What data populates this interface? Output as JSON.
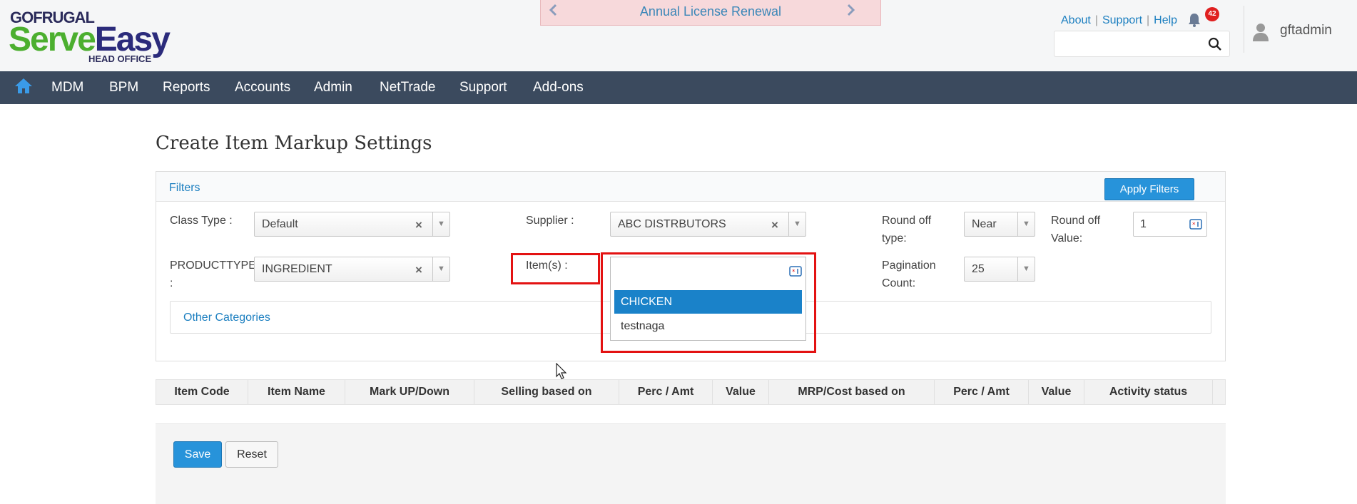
{
  "brand": {
    "top": "GOFRUGAL",
    "serve": "Serve",
    "easy": "Easy",
    "sub": "HEAD OFFICE"
  },
  "banner": {
    "text": "Annual License Renewal",
    "prev_icon": "chevron-left-icon",
    "next_icon": "chevron-right-icon"
  },
  "toplinks": {
    "about": "About",
    "support": "Support",
    "help": "Help",
    "notifications": "42"
  },
  "search": {
    "placeholder": "",
    "icon": "search-icon"
  },
  "user": {
    "name": "gftadmin",
    "icon": "user-icon"
  },
  "nav": {
    "items": [
      "MDM",
      "BPM",
      "Reports",
      "Accounts",
      "Admin",
      "NetTrade",
      "Support",
      "Add-ons"
    ]
  },
  "page": {
    "title": "Create Item Markup Settings"
  },
  "filters": {
    "title": "Filters",
    "apply_label": "Apply Filters",
    "class_type": {
      "label": "Class Type :",
      "value": "Default"
    },
    "supplier": {
      "label": "Supplier :",
      "value": "ABC DISTRBUTORS"
    },
    "round_off_type": {
      "label_1": "Round off",
      "label_2": "type:",
      "value": "Near"
    },
    "round_off_value": {
      "label_1": "Round off",
      "label_2": "Value:",
      "value": "1"
    },
    "product_type": {
      "label_1": "PRODUCTTYPE",
      "label_2": ":",
      "value": "INGREDIENT"
    },
    "items": {
      "label": "Item(s) :",
      "input_value": "",
      "options": [
        "CHICKEN",
        "testnaga"
      ],
      "highlighted": "CHICKEN"
    },
    "pagination": {
      "label_1": "Pagination",
      "label_2": "Count:",
      "value": "25"
    },
    "other_categories": "Other Categories"
  },
  "table": {
    "columns": [
      "Item Code",
      "Item Name",
      "Mark UP/Down",
      "Selling based on",
      "Perc / Amt",
      "Value",
      "MRP/Cost based on",
      "Perc / Amt",
      "Value",
      "Activity status"
    ]
  },
  "actions": {
    "save": "Save",
    "reset": "Reset"
  },
  "colors": {
    "nav_bg": "#3b4a5e",
    "primary": "#2793da",
    "highlight": "#e31212"
  }
}
